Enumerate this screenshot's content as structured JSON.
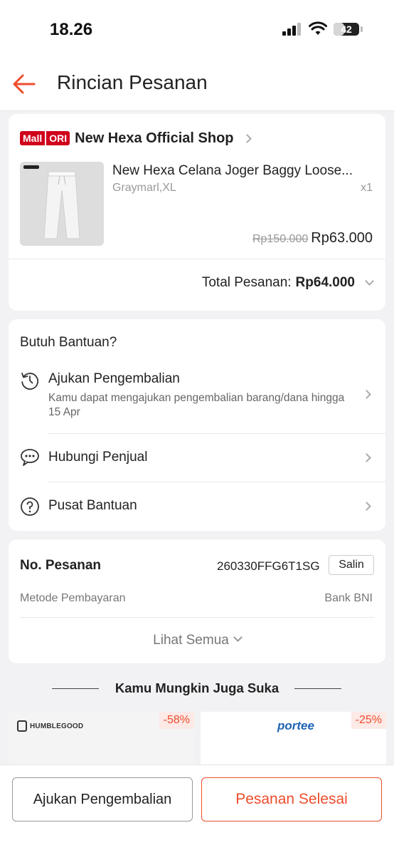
{
  "status_bar": {
    "time": "18.26",
    "battery": "42",
    "battery_level": 0.42
  },
  "header": {
    "title": "Rincian Pesanan",
    "back_icon": "arrow-left-icon"
  },
  "colors": {
    "accent": "#ee4d2d",
    "mall_red": "#d0011b"
  },
  "shop": {
    "badge_mall": "Mall",
    "badge_ori": "ORI",
    "name": "New Hexa Official Shop"
  },
  "product": {
    "name": "New Hexa Celana Joger Baggy Loose...",
    "variant": "Graymarl,XL",
    "qty": "x1",
    "price_original": "Rp150.000",
    "price": "Rp63.000"
  },
  "order_total": {
    "label": "Total Pesanan:",
    "value": "Rp64.000"
  },
  "help": {
    "title": "Butuh Bantuan?",
    "items": [
      {
        "label": "Ajukan Pengembalian",
        "description": "Kamu dapat mengajukan pengembalian barang/dana hingga 15 Apr",
        "icon": "return-icon"
      },
      {
        "label": "Hubungi Penjual",
        "icon": "chat-icon"
      },
      {
        "label": "Pusat Bantuan",
        "icon": "help-icon"
      }
    ]
  },
  "order": {
    "number_label": "No. Pesanan",
    "number": "260330FFG6T1SG",
    "copy_label": "Salin",
    "payment_label": "Metode Pembayaran",
    "payment_value": "Bank BNI",
    "see_all": "Lihat Semua"
  },
  "recommend": {
    "title": "Kamu Mungkin Juga Suka",
    "items": [
      {
        "brand": "HUMBLEGOOD",
        "discount": "-58%"
      },
      {
        "brand": "portee",
        "discount": "-25%"
      }
    ]
  },
  "actions": {
    "return_label": "Ajukan Pengembalian",
    "complete_label": "Pesanan Selesai"
  }
}
